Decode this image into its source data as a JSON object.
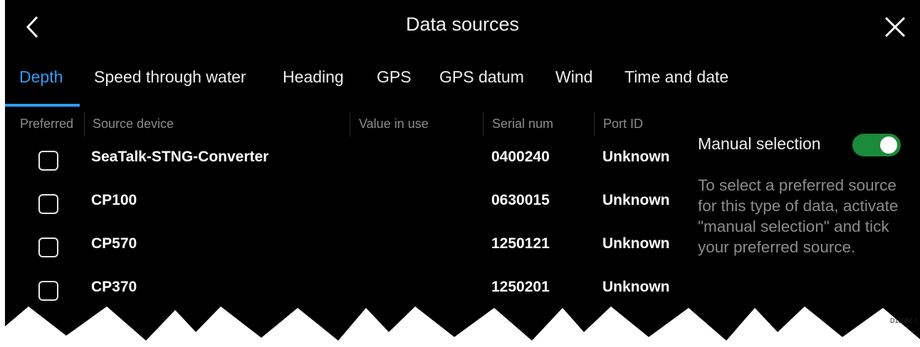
{
  "header": {
    "title": "Data sources"
  },
  "tabs": [
    {
      "label": "Depth",
      "active": true
    },
    {
      "label": "Speed through water"
    },
    {
      "label": "Heading"
    },
    {
      "label": "GPS"
    },
    {
      "label": "GPS datum"
    },
    {
      "label": "Wind"
    },
    {
      "label": "Time and date"
    }
  ],
  "table": {
    "headers": [
      "Preferred",
      "Source device",
      "Value in use",
      "Serial num",
      "Port ID"
    ],
    "rows": [
      {
        "device": "SeaTalk-STNG-Converter",
        "value": "",
        "serial": "0400240",
        "port": "Unknown",
        "checked": false
      },
      {
        "device": "CP100",
        "value": "",
        "serial": "0630015",
        "port": "Unknown",
        "checked": false
      },
      {
        "device": "CP570",
        "value": "",
        "serial": "1250121",
        "port": "Unknown",
        "checked": false
      },
      {
        "device": "CP370",
        "value": "",
        "serial": "1250201",
        "port": "Unknown",
        "checked": false
      }
    ]
  },
  "manual_selection": {
    "label": "Manual selection",
    "enabled": true,
    "help": "To select a preferred source for this type of data, activate \"manual selection\" and tick your preferred source."
  },
  "figure_code": "D13683-1",
  "colors": {
    "accent": "#2f9bf2",
    "toggle_on": "#1b8a3a",
    "background": "#000000",
    "muted_text": "#8c8c8c"
  },
  "icons": {
    "back": "chevron-left-icon",
    "close": "close-icon",
    "checkbox": "checkbox-icon"
  }
}
